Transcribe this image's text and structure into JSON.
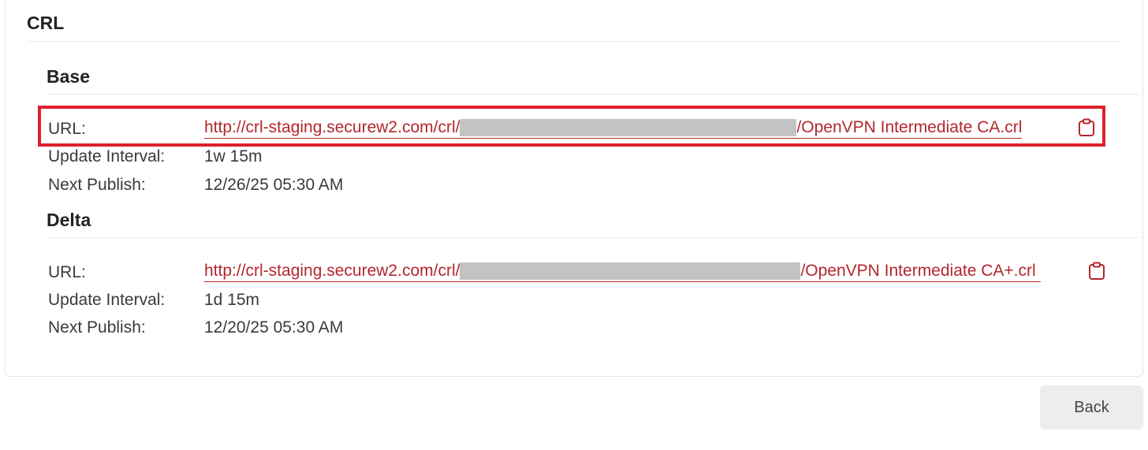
{
  "crl": {
    "title": "CRL",
    "base": {
      "title": "Base",
      "url_label": "URL:",
      "url_prefix": "http://crl-staging.securew2.com/crl/",
      "url_suffix": "/OpenVPN Intermediate CA.crl",
      "update_interval_label": "Update Interval:",
      "update_interval": "1w 15m",
      "next_publish_label": "Next Publish:",
      "next_publish": "12/26/25 05:30 AM"
    },
    "delta": {
      "title": "Delta",
      "url_label": "URL:",
      "url_prefix": "http://crl-staging.securew2.com/crl/",
      "url_suffix": "/OpenVPN Intermediate CA+.crl ",
      "update_interval_label": "Update Interval:",
      "update_interval": "1d 15m",
      "next_publish_label": "Next Publish:",
      "next_publish": "12/20/25 05:30 AM"
    }
  },
  "actions": {
    "back_label": "Back"
  },
  "icons": {
    "copy": "clipboard-icon"
  },
  "colors": {
    "link": "#b3262d",
    "highlight": "#e11f2b",
    "redaction": "#c3c3c3",
    "button_bg": "#ededed"
  }
}
